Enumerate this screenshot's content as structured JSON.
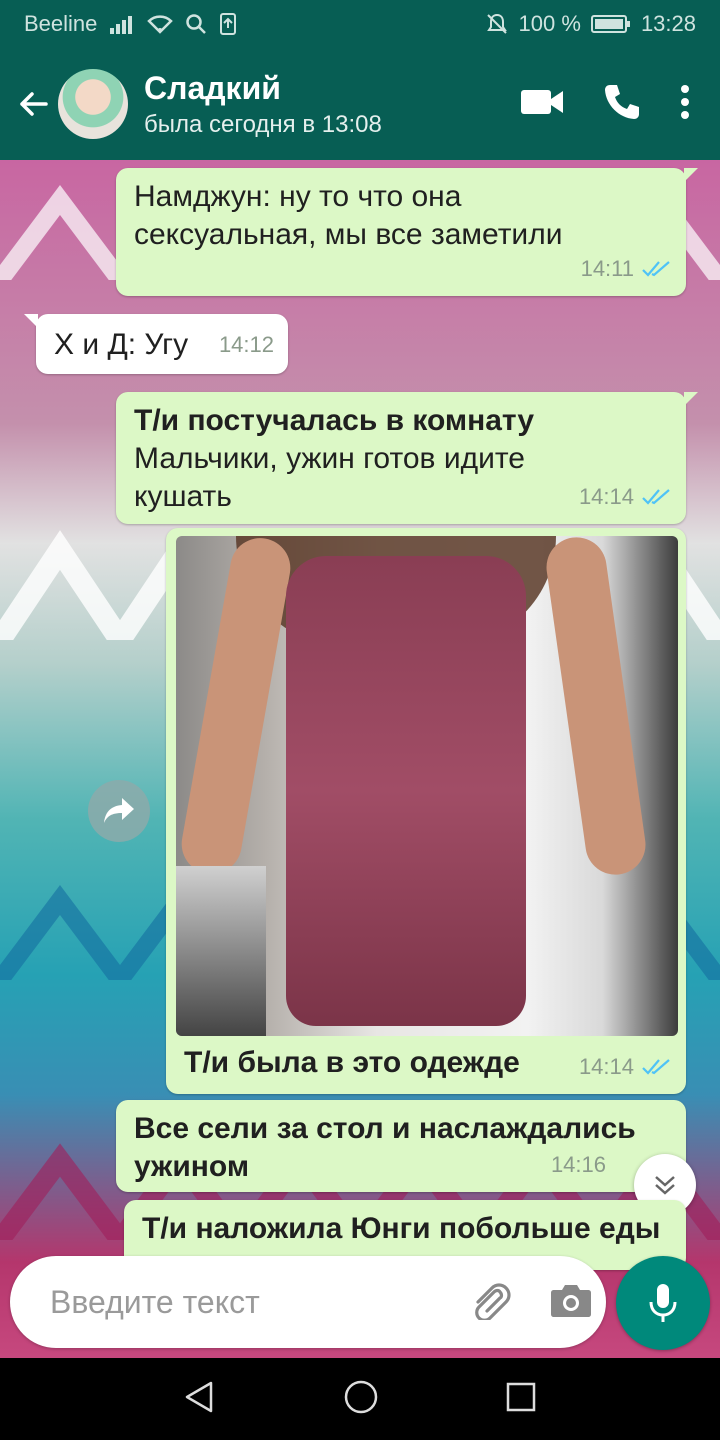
{
  "status_bar": {
    "carrier": "Beeline",
    "battery": "100 %",
    "time": "13:28"
  },
  "header": {
    "contact_name": "Сладкий",
    "last_seen": "была сегодня в 13:08"
  },
  "messages": [
    {
      "direction": "out",
      "text_lines": [
        "Намджун: ну то что она",
        "сексуальная, мы все заметили"
      ],
      "time": "14:11",
      "read": true
    },
    {
      "direction": "in",
      "text_lines": [
        "Х и Д: Угу"
      ],
      "time": "14:12"
    },
    {
      "direction": "out",
      "bold_line": "Т/и постучалась в комнату",
      "text_lines": [
        "Мальчики, ужин готов идите",
        "кушать"
      ],
      "time": "14:14",
      "read": true
    },
    {
      "direction": "out",
      "type": "image",
      "caption": "Т/и была в это одежде",
      "time": "14:14",
      "read": true
    },
    {
      "direction": "out",
      "bold_lines": [
        "Все сели за стол и наслаждались",
        "ужином"
      ],
      "time": "14:16"
    },
    {
      "direction": "out",
      "bold_lines": [
        "Т/и наложила Юнги побольше еды"
      ]
    }
  ],
  "input": {
    "placeholder": "Введите текст"
  },
  "colors": {
    "header": "#075e54",
    "outgoing_bubble": "#dcf8c6",
    "incoming_bubble": "#ffffff",
    "mic_button": "#00897b",
    "read_ticks": "#4fc3f7"
  }
}
